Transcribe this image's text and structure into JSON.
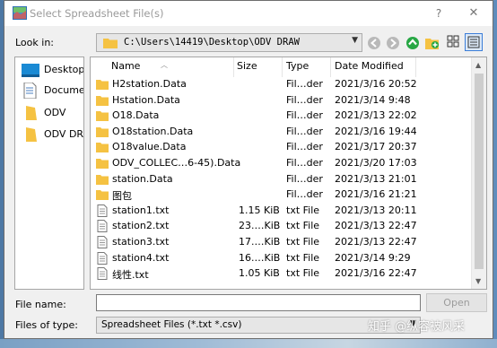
{
  "window": {
    "title": "Select Spreadsheet File(s)",
    "help": "?",
    "close": "✕"
  },
  "lookin": {
    "label": "Look in:",
    "path": "C:\\Users\\14419\\Desktop\\ODV DRAW"
  },
  "sidebar": {
    "items": [
      {
        "label": "Desktop",
        "icon": "desktop-icon"
      },
      {
        "label": "Docume…",
        "icon": "document-icon"
      },
      {
        "label": "ODV",
        "icon": "folder-icon"
      },
      {
        "label": "ODV DRAW",
        "icon": "folder-icon"
      }
    ]
  },
  "columns": {
    "name": "Name",
    "size": "Size",
    "type": "Type",
    "date": "Date Modified"
  },
  "files": [
    {
      "name": "H2station.Data",
      "size": "",
      "type": "Fil…der",
      "date": "2021/3/16 20:52",
      "icon": "folder-icon"
    },
    {
      "name": "Hstation.Data",
      "size": "",
      "type": "Fil…der",
      "date": "2021/3/14 9:48",
      "icon": "folder-icon"
    },
    {
      "name": "O18.Data",
      "size": "",
      "type": "Fil…der",
      "date": "2021/3/13 22:02",
      "icon": "folder-icon"
    },
    {
      "name": "O18station.Data",
      "size": "",
      "type": "Fil…der",
      "date": "2021/3/16 19:44",
      "icon": "folder-icon"
    },
    {
      "name": "O18value.Data",
      "size": "",
      "type": "Fil…der",
      "date": "2021/3/17 20:37",
      "icon": "folder-icon"
    },
    {
      "name": "ODV_COLLEC…6-45).Data",
      "size": "",
      "type": "Fil…der",
      "date": "2021/3/20 17:03",
      "icon": "folder-icon"
    },
    {
      "name": "station.Data",
      "size": "",
      "type": "Fil…der",
      "date": "2021/3/13 21:01",
      "icon": "folder-icon"
    },
    {
      "name": "图包",
      "size": "",
      "type": "Fil…der",
      "date": "2021/3/16 21:21",
      "icon": "folder-icon"
    },
    {
      "name": "station1.txt",
      "size": "1.15 KiB",
      "type": "txt File",
      "date": "2021/3/13 20:11",
      "icon": "text-file-icon"
    },
    {
      "name": "station2.txt",
      "size": "23.…KiB",
      "type": "txt File",
      "date": "2021/3/13 22:47",
      "icon": "text-file-icon"
    },
    {
      "name": "station3.txt",
      "size": "17.…KiB",
      "type": "txt File",
      "date": "2021/3/13 22:47",
      "icon": "text-file-icon"
    },
    {
      "name": "station4.txt",
      "size": "16.…KiB",
      "type": "txt File",
      "date": "2021/3/14 9:29",
      "icon": "text-file-icon"
    },
    {
      "name": "线性.txt",
      "size": "1.05 KiB",
      "type": "txt File",
      "date": "2021/3/16 22:47",
      "icon": "text-file-icon"
    }
  ],
  "filename": {
    "label": "File name:",
    "value": ""
  },
  "open_button": "Open",
  "filetype": {
    "label": "Files of type:",
    "value": "Spreadsheet Files (*.txt *.csv)"
  },
  "watermark": "知乎 @纵容被风采",
  "colors": {
    "folder": "#f5c242",
    "accent": "#3b7dd8",
    "nav_green": "#27a744"
  }
}
